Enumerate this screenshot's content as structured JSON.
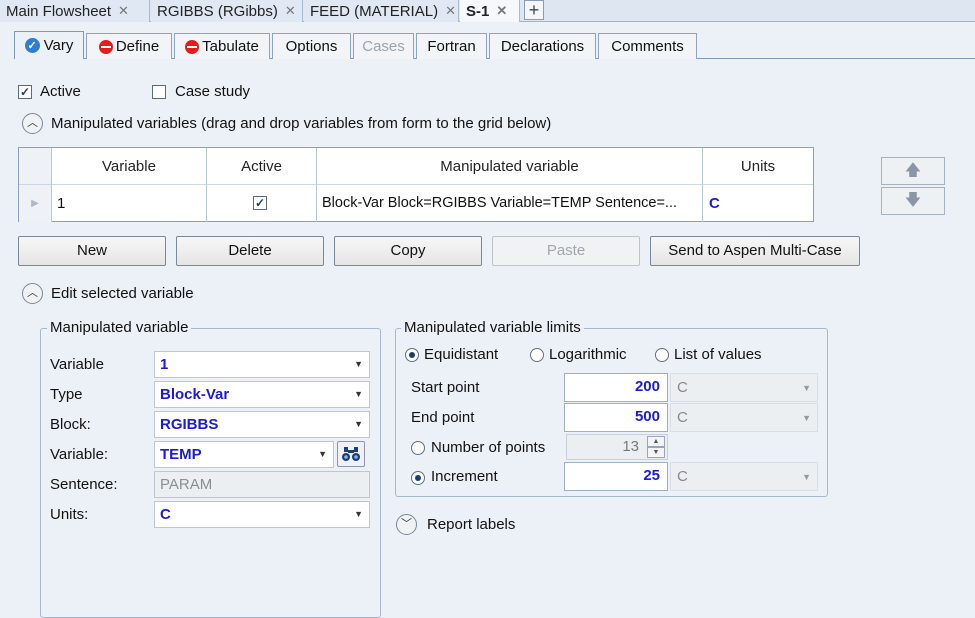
{
  "doc_tabs": [
    {
      "label": "Main Flowsheet"
    },
    {
      "label": "RGIBBS (RGibbs)"
    },
    {
      "label": "FEED (MATERIAL)"
    },
    {
      "label": "S-1"
    }
  ],
  "form_tabs": [
    {
      "label": "Vary"
    },
    {
      "label": "Define"
    },
    {
      "label": "Tabulate"
    },
    {
      "label": "Options"
    },
    {
      "label": "Cases"
    },
    {
      "label": "Fortran"
    },
    {
      "label": "Declarations"
    },
    {
      "label": "Comments"
    }
  ],
  "active_label": "Active",
  "case_study_label": "Case study",
  "manipulated_section_label": "Manipulated variables (drag and drop variables from form to the grid below)",
  "grid": {
    "headers": [
      "Variable",
      "Active",
      "Manipulated variable",
      "Units"
    ],
    "row": {
      "variable": "1",
      "manipulated": "Block-Var Block=RGIBBS Variable=TEMP Sentence=...",
      "units": "C"
    }
  },
  "buttons": {
    "new": "New",
    "delete": "Delete",
    "copy": "Copy",
    "paste": "Paste",
    "send": "Send to Aspen Multi-Case"
  },
  "edit_section_label": "Edit selected variable",
  "manip": {
    "title": "Manipulated variable",
    "fields": [
      {
        "label": "Variable",
        "value": "1"
      },
      {
        "label": "Type",
        "value": "Block-Var"
      },
      {
        "label": "Block:",
        "value": "RGIBBS"
      },
      {
        "label": "Variable:",
        "value": "TEMP"
      },
      {
        "label": "Sentence:",
        "value": "PARAM"
      },
      {
        "label": "Units:",
        "value": "C"
      }
    ]
  },
  "limits": {
    "title": "Manipulated variable limits",
    "options": [
      "Equidistant",
      "Logarithmic",
      "List of values"
    ],
    "start_label": "Start point",
    "start_value": "200",
    "start_unit": "C",
    "end_label": "End point",
    "end_value": "500",
    "end_unit": "C",
    "npoints_label": "Number of points",
    "npoints_value": "13",
    "increment_label": "Increment",
    "increment_value": "25",
    "increment_unit": "C"
  },
  "report_labels": "Report labels"
}
